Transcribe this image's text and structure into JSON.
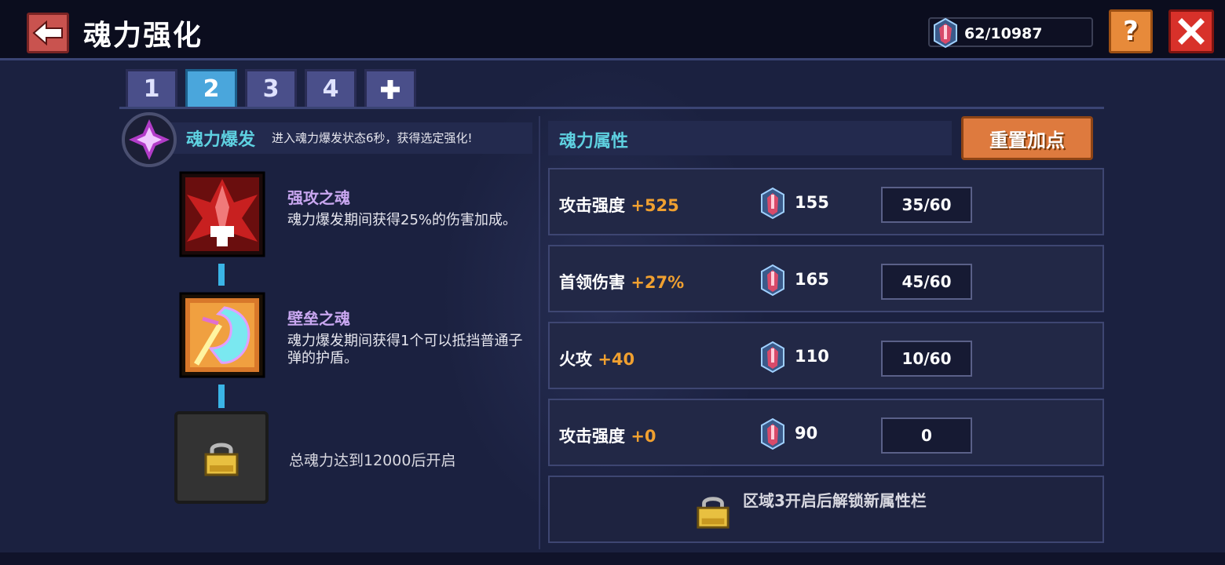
{
  "header": {
    "title": "魂力强化",
    "currency_value": "62/10987",
    "help_label": "?"
  },
  "tabs": [
    {
      "label": "1",
      "active": false
    },
    {
      "label": "2",
      "active": true
    },
    {
      "label": "3",
      "active": false
    },
    {
      "label": "4",
      "active": false
    },
    {
      "label": "+",
      "active": false
    }
  ],
  "burst": {
    "name": "魂力爆发",
    "description": "进入魂力爆发状态6秒，获得选定强化!"
  },
  "skills": [
    {
      "name": "强攻之魂",
      "description": "魂力爆发期间获得25%的伤害加成。",
      "icon": "red-winged-soul-icon"
    },
    {
      "name": "壁垒之魂",
      "description": "魂力爆发期间获得1个可以抵挡普通子弹的护盾。",
      "icon": "shield-soul-icon"
    },
    {
      "locked_text": "总魂力达到12000后开启",
      "icon": "lock-icon"
    }
  ],
  "attributes": {
    "title": "魂力属性",
    "reset_label": "重置加点",
    "rows": [
      {
        "label": "攻击强度",
        "bonus": "+525",
        "cost": "155",
        "level": "35/60"
      },
      {
        "label": "首领伤害",
        "bonus": "+27%",
        "cost": "165",
        "level": "45/60"
      },
      {
        "label": "火攻",
        "bonus": "+40",
        "cost": "110",
        "level": "10/60"
      },
      {
        "label": "攻击强度",
        "bonus": "+0",
        "cost": "90",
        "level": "0"
      }
    ],
    "locked_row_text": "区域3开启后解锁新属性栏"
  },
  "colors": {
    "accent_cyan": "#5ed0e0",
    "bonus_orange": "#f0a030",
    "close_red": "#d8312a",
    "help_orange": "#e78a3a"
  }
}
